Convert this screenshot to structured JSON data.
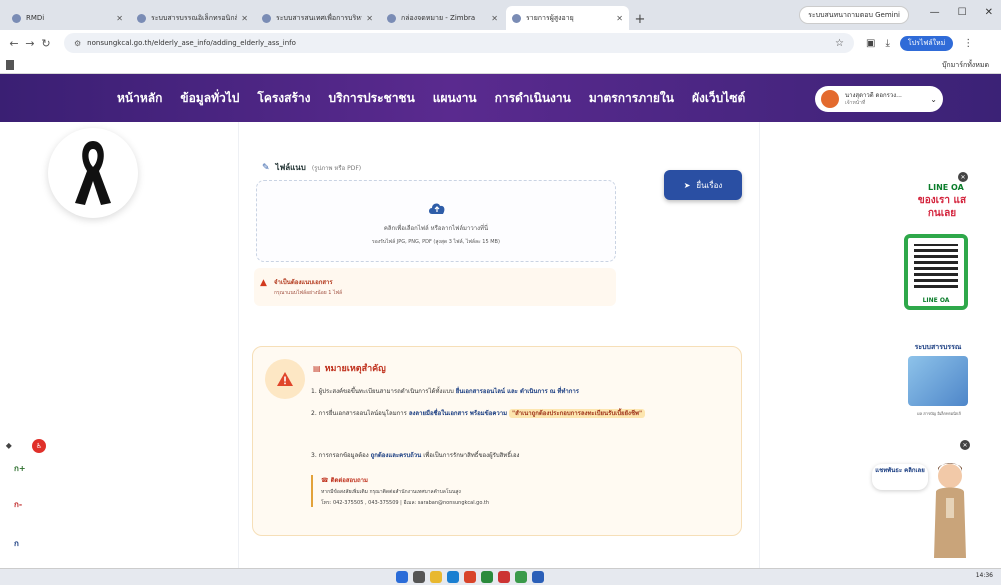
{
  "browser": {
    "tabs": [
      {
        "title": "RMDi",
        "active": false
      },
      {
        "title": "ระบบสารบรรณอิเล็กทรอนิกส์",
        "active": false
      },
      {
        "title": "ระบบสารสนเทศเพื่อการบริหารจัดการ",
        "active": false
      },
      {
        "title": "กล่องจดหมาย - Zimbra",
        "active": false
      },
      {
        "title": "รายการผู้สูงอายุ",
        "active": true
      }
    ],
    "new_tab": "+",
    "gemini_label": "ระบบสนทนาถามตอบ Gemini",
    "url": "nonsungkcal.go.th/elderly_ase_info/adding_elderly_ass_info",
    "profile_label": "โปรไฟล์ใหม่",
    "bookmarks_all": "บุ๊กมาร์กทั้งหมด"
  },
  "site_nav": {
    "items": [
      "หน้าหลัก",
      "ข้อมูลทั่วไป",
      "โครงสร้าง",
      "บริการประชาชน",
      "แผนงาน",
      "การดำเนินงาน",
      "มาตรการภายใน",
      "ผังเว็บไซต์"
    ],
    "user_name": "นางสุดาวดี ดอกรวง...",
    "user_role": "เจ้าหน้าที่"
  },
  "upload": {
    "label": "ไฟล์แนบ",
    "hint": "(รูปภาพ หรือ PDF)",
    "drop_main": "คลิกเพื่อเลือกไฟล์ หรือลากไฟล์มาวางที่นี่",
    "drop_sub": "รองรับไฟล์ JPG, PNG, PDF (สูงสุด 3 ไฟล์, ไฟล์ละ 15 MB)",
    "submit": "ยื่นเรื่อง"
  },
  "warning": {
    "title": "จำเป็นต้องแนบเอกสาร",
    "sub": "กรุณาแนบไฟล์อย่างน้อย 1 ไฟล์"
  },
  "notice": {
    "title": "หมายเหตุสำคัญ",
    "item1_pre": "1. ผู้ประสงค์ขอขึ้นทะเบียนสามารถดำเนินการได้ทั้งแบบ",
    "item1_bold": "ยื่นเอกสารออนไลน์ และ ดำเนินการ ณ ที่ทำการ",
    "item2_pre": "2. การยื่นเอกสารออนไลน์อนุโลมการ",
    "item2_bold": "ลงลายมือชื่อในเอกสาร พร้อมข้อความ",
    "item2_highlight": "\"สำเนาถูกต้องประกอบการลงทะเบียนรับเบี้ยยังชีพ\"",
    "item3_pre": "3. การกรอกข้อมูลต้อง",
    "item3_bold": "ถูกต้องและครบถ้วน",
    "item3_post": "เพื่อเป็นการรักษาสิทธิ์ของผู้รับสิทธิ์เอง",
    "contact_title": "ติดต่อสอบถาม",
    "contact_line1": "หากมีข้อสงสัยเพิ่มเติม กรุณาติดต่อสำนักงานเทศบาลตำบลโนนสูง",
    "contact_line2": "โทร: 042-375505 , 043-375509 | อีเมล: saraban@nonsungkcal.go.th"
  },
  "sidebar": {
    "line_title": "LINE OA",
    "line_text": "ของเรา แสกนเลย",
    "qr_label": "LINE OA",
    "saraban_title": "ระบบสารบรรณ",
    "saraban_sub": "ผล สารบัญ อิเล็กทรอนิกส์",
    "chat_text": "แชทพันธะ คลิกเลย"
  },
  "taskbar": {
    "clock": "14:36"
  },
  "colors": {
    "nav_bg": "#4a2685",
    "submit": "#2a4fa3",
    "notice_title": "#c0321e",
    "line_green": "#2ea84a"
  }
}
